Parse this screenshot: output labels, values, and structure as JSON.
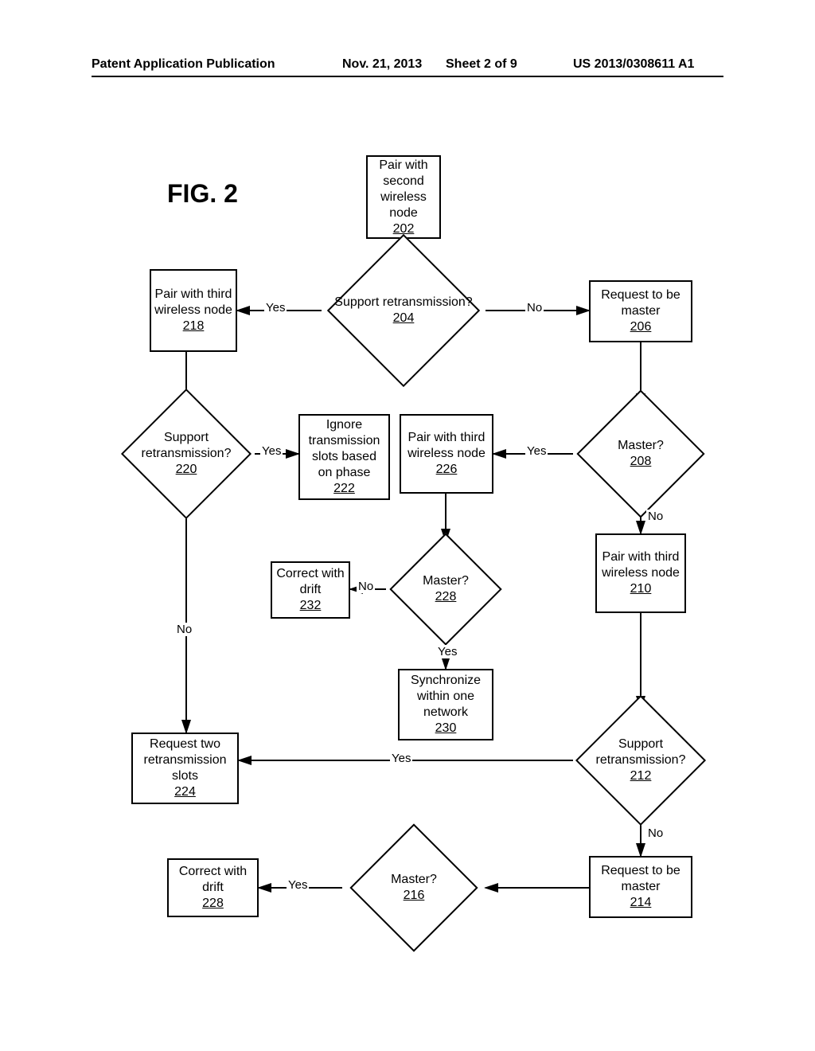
{
  "header": {
    "left": "Patent Application Publication",
    "date": "Nov. 21, 2013",
    "sheet": "Sheet 2 of 9",
    "pubno": "US 2013/0308611 A1"
  },
  "figure_label": "FIG. 2",
  "nodes": {
    "n202": {
      "text": "Pair with second wireless node",
      "ref": "202"
    },
    "n204": {
      "text": "Support retransmission?",
      "ref": "204"
    },
    "n206": {
      "text": "Request to be master",
      "ref": "206"
    },
    "n218": {
      "text": "Pair with third wireless node",
      "ref": "218"
    },
    "n220": {
      "text": "Support retransmission?",
      "ref": "220"
    },
    "n222": {
      "text": "Ignore transmission slots based on phase",
      "ref": "222"
    },
    "n226": {
      "text": "Pair with third wireless node",
      "ref": "226"
    },
    "n208": {
      "text": "Master?",
      "ref": "208"
    },
    "n210": {
      "text": "Pair with third wireless node",
      "ref": "210"
    },
    "n228": {
      "text": "Master?",
      "ref": "228"
    },
    "n232": {
      "text": "Correct with drift",
      "ref": "232"
    },
    "n230": {
      "text": "Synchronize within one network",
      "ref": "230"
    },
    "n212": {
      "text": "Support retransmission?",
      "ref": "212"
    },
    "n224": {
      "text": "Request two retransmission slots",
      "ref": "224"
    },
    "n214": {
      "text": "Request to be master",
      "ref": "214"
    },
    "n216": {
      "text": "Master?",
      "ref": "216"
    },
    "n228b": {
      "text": "Correct with drift",
      "ref": "228"
    }
  },
  "edges": {
    "yes": "Yes",
    "no": "No"
  }
}
